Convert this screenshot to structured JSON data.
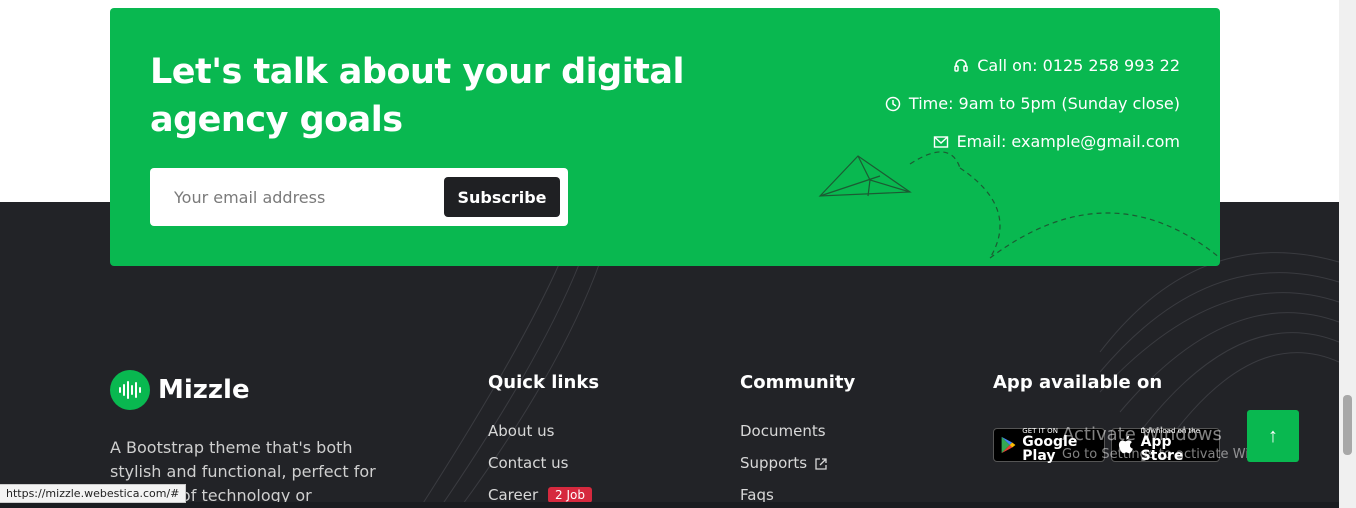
{
  "cta": {
    "title_line1": "Let's talk about your digital",
    "title_line2": "agency goals",
    "email_placeholder": "Your email address",
    "subscribe_label": "Subscribe",
    "contacts": {
      "call": "Call on: 0125 258 993 22",
      "time": "Time: 9am to 5pm (Sunday close)",
      "email": "Email: example@gmail.com"
    },
    "icons": [
      "headset-icon",
      "clock-icon",
      "envelope-icon",
      "paper-plane-icon"
    ]
  },
  "brand": {
    "name": "Mizzle",
    "description": "A Bootstrap theme that's both stylish and functional, perfect for",
    "description_cut": "e of technology or"
  },
  "quick_links": {
    "title": "Quick links",
    "items": [
      "About us",
      "Contact us",
      "Career"
    ],
    "career_badge": "2 Job"
  },
  "community": {
    "title": "Community",
    "items": [
      "Documents",
      "Supports",
      "Faqs"
    ]
  },
  "apps": {
    "title": "App available on",
    "google_small": "GET IT ON",
    "google_big": "Google Play",
    "apple_small": "Download on the",
    "apple_big": "App Store"
  },
  "watermark": {
    "line1": "Activate Windows",
    "line2": "Go to Settings to activate Windows."
  },
  "status_bar_url": "https://mizzle.webestica.com/#",
  "back_to_top": "↑",
  "colors": {
    "accent": "#09b850",
    "dark_bg": "#222327",
    "badge": "#d6293e"
  }
}
